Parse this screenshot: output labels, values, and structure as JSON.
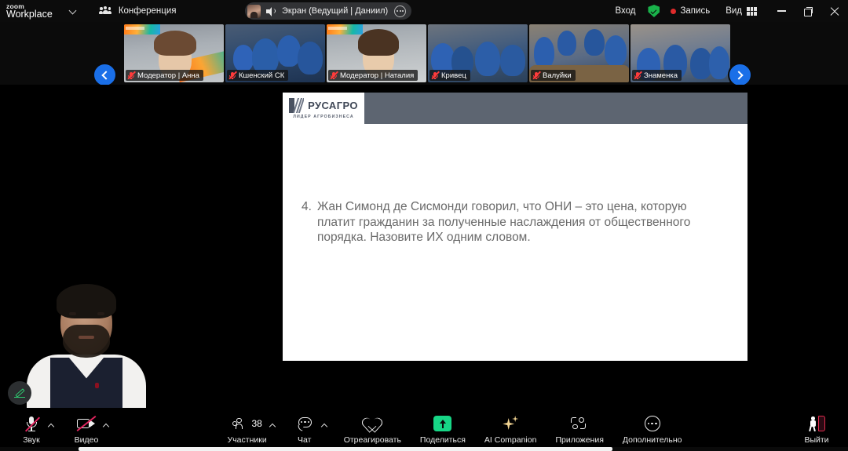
{
  "topbar": {
    "brand_line1": "zoom",
    "brand_line2": "Workplace",
    "dropdown_icon": "chevron-down-icon",
    "conference_label": "Конференция",
    "conference_icon": "people-icon",
    "share_pill": {
      "avatar_icon": "presenter-avatar",
      "speaker_icon": "speaker-icon",
      "label": "Экран (Ведущий | Даниил)",
      "more_icon": "more-options-icon"
    },
    "login_label": "Вход",
    "shield_icon": "encryption-shield-icon",
    "recording_label": "Запись",
    "recording_dot_color": "#e02b2b",
    "view_label": "Вид",
    "view_icon": "grid-view-icon",
    "minimize_icon": "minimize-icon",
    "maximize_icon": "maximize-icon",
    "close_icon": "close-icon"
  },
  "filmstrip": {
    "prev_icon": "chevron-left-icon",
    "next_icon": "chevron-right-icon",
    "thumbnails": [
      {
        "name": "Модератор | Анна",
        "muted": true,
        "mute_icon": "muted-mic-icon",
        "ribbon": true
      },
      {
        "name": "Кшенский СК",
        "muted": true,
        "mute_icon": "muted-mic-icon",
        "ribbon": false
      },
      {
        "name": "Модератор | Наталия",
        "muted": true,
        "mute_icon": "muted-mic-icon",
        "ribbon": true
      },
      {
        "name": "Кривец",
        "muted": true,
        "mute_icon": "muted-mic-icon",
        "ribbon": false
      },
      {
        "name": "Валуйки",
        "muted": true,
        "mute_icon": "muted-mic-icon",
        "ribbon": false
      },
      {
        "name": "Знаменка",
        "muted": true,
        "mute_icon": "muted-mic-icon",
        "ribbon": false
      }
    ]
  },
  "slide": {
    "logo_name": "РУСАГРО",
    "logo_tagline": "ЛИДЕР АГРОБИЗНЕСА",
    "header_bar_color": "#5d6571",
    "question_number": "4.",
    "question_text": "Жан Симонд де Сисмонди говорил, что ОНИ – это цена, которую платит гражданин за полученные наслаждения от общественного порядка. Назовите ИХ одним словом.",
    "text_color": "#6a6a6a"
  },
  "stage": {
    "annotate_icon": "pencil-annotate-icon",
    "annotate_color": "#2ecc71",
    "speaker_video_label": "active-speaker-video"
  },
  "toolbar": {
    "audio": {
      "label": "Звук",
      "icon": "muted-microphone-icon",
      "muted": true,
      "caret": "chevron-up-icon"
    },
    "video": {
      "label": "Видео",
      "icon": "muted-camera-icon",
      "muted": true,
      "caret": "chevron-up-icon"
    },
    "participants": {
      "label": "Участники",
      "icon": "participants-icon",
      "count": "38",
      "caret": "chevron-up-icon"
    },
    "chat": {
      "label": "Чат",
      "icon": "chat-bubble-icon",
      "caret": "chevron-up-icon"
    },
    "react": {
      "label": "Отреагировать",
      "icon": "heart-icon"
    },
    "share": {
      "label": "Поделиться",
      "icon": "share-screen-icon",
      "color": "#17d686"
    },
    "ai": {
      "label": "AI Companion",
      "icon": "sparkle-icon",
      "color": "#f2d492"
    },
    "apps": {
      "label": "Приложения",
      "icon": "apps-icon"
    },
    "more": {
      "label": "Дополнительно",
      "icon": "more-dots-icon"
    },
    "leave": {
      "label": "Выйти",
      "icon": "leave-meeting-icon",
      "color": "#e02b4d"
    }
  }
}
